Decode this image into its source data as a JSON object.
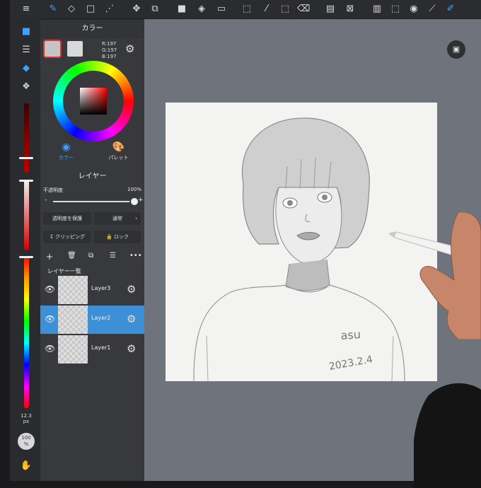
{
  "toolbar": {
    "icons": [
      "brush-icon",
      "eraser-icon",
      "rectangle-icon",
      "magic-wand-icon",
      "move-icon",
      "transform-icon",
      "fill-icon",
      "bucket-icon",
      "gradient-icon",
      "select-icon",
      "eyedropper-icon",
      "clear-icon",
      "layout-icon",
      "window-icon",
      "pages-icon",
      "snap-icon",
      "ruler-icon",
      "pen-icon"
    ]
  },
  "color_panel": {
    "title": "カラー",
    "rgb_r": "R:197",
    "rgb_g": "G:197",
    "rgb_b": "B:197",
    "primary_color": "#c5c5c5",
    "secondary_color": "#d9d9d9",
    "tab_color": "カラー",
    "tab_palette": "パレット"
  },
  "layer_panel": {
    "title": "レイヤー",
    "opacity_label": "不透明度",
    "opacity_value": "100%",
    "opacity_fraction": 1.0,
    "minus": "-",
    "plus": "+",
    "protect_alpha": "透明度を保護",
    "blend_mode": "通常",
    "clipping": "クリッピング",
    "lock": "ロック",
    "list_title": "レイヤー一覧",
    "layers": [
      {
        "name": "Layer3",
        "selected": false
      },
      {
        "name": "Layer2",
        "selected": true
      },
      {
        "name": "Layer1",
        "selected": false
      }
    ]
  },
  "left_strip": {
    "zoom_text": "100\n%",
    "brush_size_label": "12.3",
    "brush_size_unit": "px"
  },
  "artwork": {
    "signature": "asu",
    "date": "2023.2.4"
  },
  "colors": {
    "accent": "#3d8fd6",
    "canvas_bg": "#6f737c",
    "paper": "#f3f3f1",
    "panel": "#38393d"
  }
}
